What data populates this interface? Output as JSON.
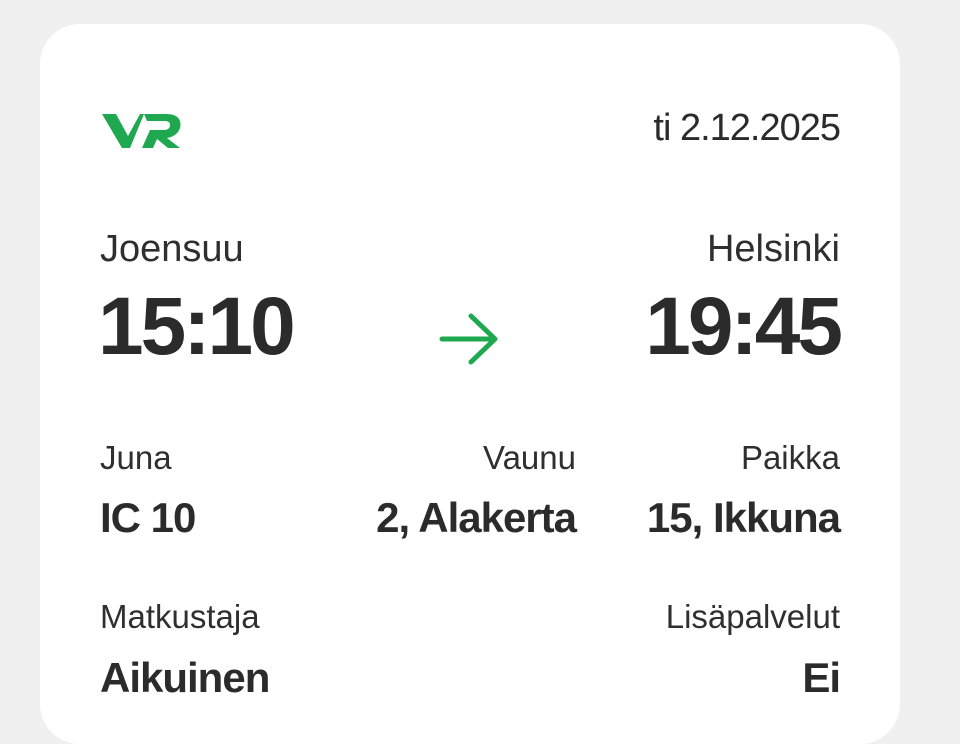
{
  "brand": {
    "logo_text": "VR",
    "accent_color": "#1fa84f"
  },
  "ticket": {
    "date": "ti 2.12.2025",
    "departure": {
      "station": "Joensuu",
      "time": "15:10"
    },
    "arrival": {
      "station": "Helsinki",
      "time": "19:45"
    },
    "arrow_icon": "arrow-right-icon",
    "train": {
      "label": "Juna",
      "value": "IC 10"
    },
    "car": {
      "label": "Vaunu",
      "value": "2, Alakerta"
    },
    "seat": {
      "label": "Paikka",
      "value": "15, Ikkuna"
    },
    "passenger": {
      "label": "Matkustaja",
      "value": "Aikuinen"
    },
    "extras": {
      "label": "Lisäpalvelut",
      "value": "Ei"
    }
  }
}
